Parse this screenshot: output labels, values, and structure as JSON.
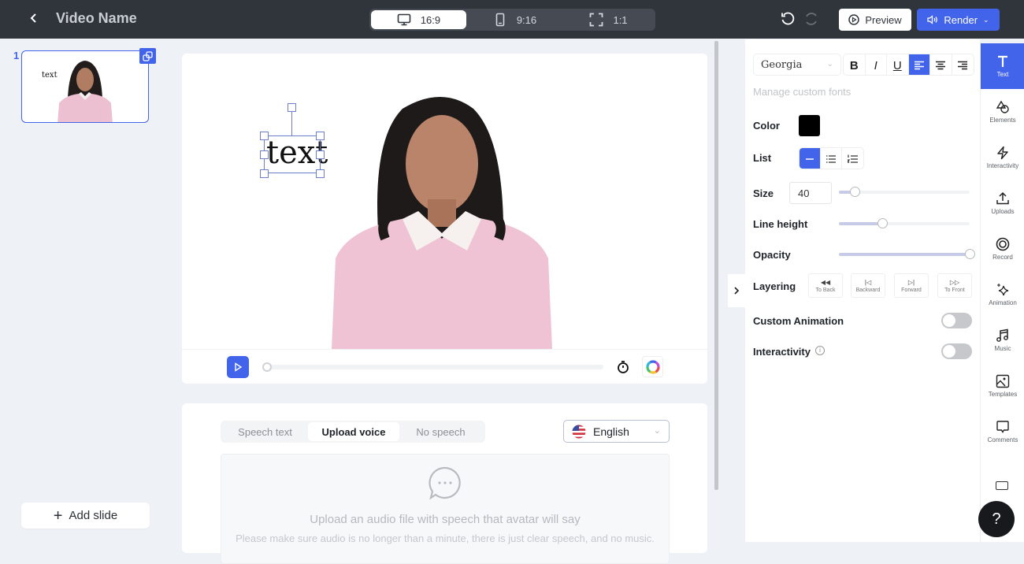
{
  "header": {
    "title": "Video Name",
    "aspect_ratios": [
      {
        "label": "16:9",
        "icon": "monitor-icon",
        "active": true
      },
      {
        "label": "9:16",
        "icon": "phone-icon",
        "active": false
      },
      {
        "label": "1:1",
        "icon": "square-frame-icon",
        "active": false
      }
    ],
    "preview_label": "Preview",
    "render_label": "Render"
  },
  "slides": {
    "items": [
      {
        "number": "1",
        "thumb_text": "text"
      }
    ],
    "add_slide_label": "Add slide"
  },
  "canvas": {
    "text_element": "text",
    "progress": 0
  },
  "speech": {
    "tabs": [
      {
        "label": "Speech text",
        "active": false
      },
      {
        "label": "Upload voice",
        "active": true
      },
      {
        "label": "No speech",
        "active": false
      }
    ],
    "language": "English",
    "upload_title": "Upload an audio file with speech that avatar will say",
    "upload_subtitle": "Please make sure audio is no longer than a minute, there is just clear speech, and no music."
  },
  "properties": {
    "font": "Georgia",
    "manage_fonts_label": "Manage custom fonts",
    "format_buttons": [
      "B",
      "I",
      "U"
    ],
    "alignment": "left",
    "color_label": "Color",
    "color_value": "#000000",
    "list_label": "List",
    "list_mode": "none",
    "size_label": "Size",
    "size_value": "40",
    "size_slider_fraction": 0.12,
    "line_height_label": "Line height",
    "line_height_fraction": 0.33,
    "opacity_label": "Opacity",
    "opacity_fraction": 1.0,
    "layering_label": "Layering",
    "layering_buttons": [
      "To Back",
      "Backward",
      "Forward",
      "To Front"
    ],
    "custom_animation_label": "Custom Animation",
    "custom_animation_on": false,
    "interactivity_label": "Interactivity",
    "interactivity_on": false
  },
  "sidebar": {
    "items": [
      {
        "label": "Text",
        "icon": "text-icon",
        "active": true
      },
      {
        "label": "Elements",
        "icon": "shapes-icon"
      },
      {
        "label": "Interactivity",
        "icon": "lightning-icon"
      },
      {
        "label": "Uploads",
        "icon": "upload-icon"
      },
      {
        "label": "Record",
        "icon": "record-icon"
      },
      {
        "label": "Animation",
        "icon": "sparkle-icon"
      },
      {
        "label": "Music",
        "icon": "music-icon"
      },
      {
        "label": "Templates",
        "icon": "image-icon"
      },
      {
        "label": "Comments",
        "icon": "comment-icon"
      }
    ],
    "help_label": "?"
  },
  "colors": {
    "accent": "#4264ea",
    "topbar": "#30343b",
    "background": "#eef1f5"
  }
}
